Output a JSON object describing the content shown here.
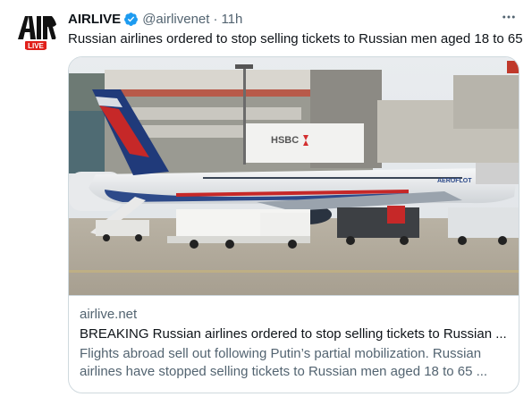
{
  "tweet": {
    "avatar": {
      "logo_text": "AIR",
      "badge_text": "LIVE",
      "icon": "airlive-logo-icon"
    },
    "author_name": "AIRLIVE",
    "verified_icon": "verified-badge-icon",
    "handle": "@airlivenet",
    "separator": "·",
    "timestamp": "11h",
    "more_icon": "more-options-icon",
    "text": "Russian airlines ordered to stop selling tickets to Russian men aged 18 to 65"
  },
  "card": {
    "image_description_icon": "aircraft-photo",
    "image_texts": {
      "hangar_sign": "HSBC",
      "livery": "AEROFLOT"
    },
    "domain": "airlive.net",
    "title": "BREAKING Russian airlines ordered to stop selling tickets to Russian ...",
    "description_line1": "Flights abroad sell out following Putin’s partial mobilization. Russian",
    "description_line2": "airlines have stopped selling tickets to Russian men aged 18 to 65 ..."
  },
  "colors": {
    "accent": "#1d9bf0",
    "text_primary": "#0f1419",
    "text_secondary": "#536471",
    "border": "#cfd9de",
    "badge_red": "#e0201b"
  }
}
